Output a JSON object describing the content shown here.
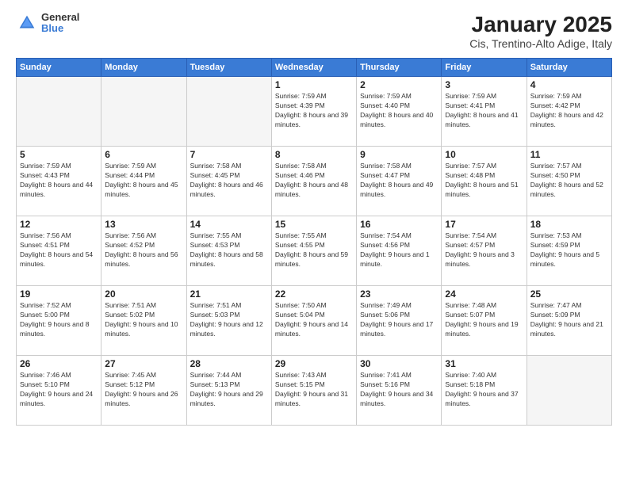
{
  "header": {
    "logo": {
      "general": "General",
      "blue": "Blue"
    },
    "title": "January 2025",
    "location": "Cis, Trentino-Alto Adige, Italy"
  },
  "calendar": {
    "days_of_week": [
      "Sunday",
      "Monday",
      "Tuesday",
      "Wednesday",
      "Thursday",
      "Friday",
      "Saturday"
    ],
    "weeks": [
      [
        {
          "day": "",
          "empty": true
        },
        {
          "day": "",
          "empty": true
        },
        {
          "day": "",
          "empty": true
        },
        {
          "day": "1",
          "sunrise": "7:59 AM",
          "sunset": "4:39 PM",
          "daylight": "8 hours and 39 minutes."
        },
        {
          "day": "2",
          "sunrise": "7:59 AM",
          "sunset": "4:40 PM",
          "daylight": "8 hours and 40 minutes."
        },
        {
          "day": "3",
          "sunrise": "7:59 AM",
          "sunset": "4:41 PM",
          "daylight": "8 hours and 41 minutes."
        },
        {
          "day": "4",
          "sunrise": "7:59 AM",
          "sunset": "4:42 PM",
          "daylight": "8 hours and 42 minutes."
        }
      ],
      [
        {
          "day": "5",
          "sunrise": "7:59 AM",
          "sunset": "4:43 PM",
          "daylight": "8 hours and 44 minutes."
        },
        {
          "day": "6",
          "sunrise": "7:59 AM",
          "sunset": "4:44 PM",
          "daylight": "8 hours and 45 minutes."
        },
        {
          "day": "7",
          "sunrise": "7:58 AM",
          "sunset": "4:45 PM",
          "daylight": "8 hours and 46 minutes."
        },
        {
          "day": "8",
          "sunrise": "7:58 AM",
          "sunset": "4:46 PM",
          "daylight": "8 hours and 48 minutes."
        },
        {
          "day": "9",
          "sunrise": "7:58 AM",
          "sunset": "4:47 PM",
          "daylight": "8 hours and 49 minutes."
        },
        {
          "day": "10",
          "sunrise": "7:57 AM",
          "sunset": "4:48 PM",
          "daylight": "8 hours and 51 minutes."
        },
        {
          "day": "11",
          "sunrise": "7:57 AM",
          "sunset": "4:50 PM",
          "daylight": "8 hours and 52 minutes."
        }
      ],
      [
        {
          "day": "12",
          "sunrise": "7:56 AM",
          "sunset": "4:51 PM",
          "daylight": "8 hours and 54 minutes."
        },
        {
          "day": "13",
          "sunrise": "7:56 AM",
          "sunset": "4:52 PM",
          "daylight": "8 hours and 56 minutes."
        },
        {
          "day": "14",
          "sunrise": "7:55 AM",
          "sunset": "4:53 PM",
          "daylight": "8 hours and 58 minutes."
        },
        {
          "day": "15",
          "sunrise": "7:55 AM",
          "sunset": "4:55 PM",
          "daylight": "8 hours and 59 minutes."
        },
        {
          "day": "16",
          "sunrise": "7:54 AM",
          "sunset": "4:56 PM",
          "daylight": "9 hours and 1 minute."
        },
        {
          "day": "17",
          "sunrise": "7:54 AM",
          "sunset": "4:57 PM",
          "daylight": "9 hours and 3 minutes."
        },
        {
          "day": "18",
          "sunrise": "7:53 AM",
          "sunset": "4:59 PM",
          "daylight": "9 hours and 5 minutes."
        }
      ],
      [
        {
          "day": "19",
          "sunrise": "7:52 AM",
          "sunset": "5:00 PM",
          "daylight": "9 hours and 8 minutes."
        },
        {
          "day": "20",
          "sunrise": "7:51 AM",
          "sunset": "5:02 PM",
          "daylight": "9 hours and 10 minutes."
        },
        {
          "day": "21",
          "sunrise": "7:51 AM",
          "sunset": "5:03 PM",
          "daylight": "9 hours and 12 minutes."
        },
        {
          "day": "22",
          "sunrise": "7:50 AM",
          "sunset": "5:04 PM",
          "daylight": "9 hours and 14 minutes."
        },
        {
          "day": "23",
          "sunrise": "7:49 AM",
          "sunset": "5:06 PM",
          "daylight": "9 hours and 17 minutes."
        },
        {
          "day": "24",
          "sunrise": "7:48 AM",
          "sunset": "5:07 PM",
          "daylight": "9 hours and 19 minutes."
        },
        {
          "day": "25",
          "sunrise": "7:47 AM",
          "sunset": "5:09 PM",
          "daylight": "9 hours and 21 minutes."
        }
      ],
      [
        {
          "day": "26",
          "sunrise": "7:46 AM",
          "sunset": "5:10 PM",
          "daylight": "9 hours and 24 minutes."
        },
        {
          "day": "27",
          "sunrise": "7:45 AM",
          "sunset": "5:12 PM",
          "daylight": "9 hours and 26 minutes."
        },
        {
          "day": "28",
          "sunrise": "7:44 AM",
          "sunset": "5:13 PM",
          "daylight": "9 hours and 29 minutes."
        },
        {
          "day": "29",
          "sunrise": "7:43 AM",
          "sunset": "5:15 PM",
          "daylight": "9 hours and 31 minutes."
        },
        {
          "day": "30",
          "sunrise": "7:41 AM",
          "sunset": "5:16 PM",
          "daylight": "9 hours and 34 minutes."
        },
        {
          "day": "31",
          "sunrise": "7:40 AM",
          "sunset": "5:18 PM",
          "daylight": "9 hours and 37 minutes."
        },
        {
          "day": "",
          "empty": true
        }
      ]
    ]
  }
}
